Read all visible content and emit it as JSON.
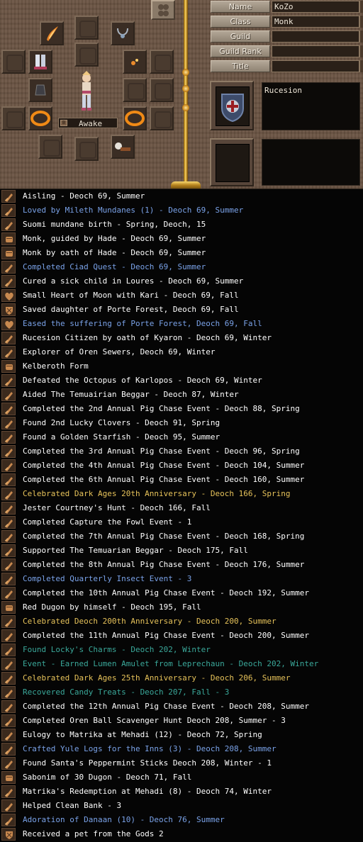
{
  "profile": {
    "status_label": "Awake",
    "status_hotkey": "B",
    "name_label": "Name",
    "name_value": "KoZo",
    "class_label": "Class",
    "class_value": "Monk",
    "guild_label": "Guild",
    "guild_value": "",
    "guild_rank_label": "Guild Rank",
    "guild_rank_value": "",
    "title_label": "Title",
    "title_value": "",
    "nation_value": "Rucesion"
  },
  "equipment_slots": [
    "helmet-ghost",
    "shield-ghost",
    "weapon",
    "earring-ghost",
    "necklace",
    "armor-ghost",
    "ring-left-ghost",
    "boots",
    "ring-right-ghost",
    "greaves-ghost",
    "gauntlet-left",
    "gauntlet-right",
    "belt-ghost",
    "accessory-ghost",
    "overcoat",
    "accessory2-ghost",
    "skull-item"
  ],
  "colors": {
    "white": "#ffffff",
    "blue": "#7aa2e8",
    "gold": "#e6c25a",
    "teal": "#3aa89a",
    "panel_brown": "#6a5443",
    "pole_gold": "#d9a52a"
  },
  "legend": [
    {
      "icon": "sword",
      "color": "white",
      "text": "Aisling - Deoch 69, Summer"
    },
    {
      "icon": "sword",
      "color": "blue",
      "text": "Loved by Mileth Mundanes (1) - Deoch 69, Summer"
    },
    {
      "icon": "sword",
      "color": "white",
      "text": "Suomi mundane birth - Spring, Deoch, 15"
    },
    {
      "icon": "fist",
      "color": "white",
      "text": "Monk, guided by Hade - Deoch 69, Summer"
    },
    {
      "icon": "fist",
      "color": "white",
      "text": "Monk by oath of Hade - Deoch 69, Summer"
    },
    {
      "icon": "sword",
      "color": "blue",
      "text": "Completed Ciad Quest - Deoch 69, Summer"
    },
    {
      "icon": "sword",
      "color": "white",
      "text": "Cured a sick child in Loures - Deoch 69, Summer"
    },
    {
      "icon": "heart",
      "color": "white",
      "text": "Small Heart of Moon with Kari - Deoch 69, Fall"
    },
    {
      "icon": "shield",
      "color": "white",
      "text": "Saved daughter of Porte Forest, Deoch 69, Fall"
    },
    {
      "icon": "heart",
      "color": "blue",
      "text": "Eased the suffering of Porte Forest, Deoch 69, Fall"
    },
    {
      "icon": "sword",
      "color": "white",
      "text": "Rucesion Citizen by oath of Kyaron - Deoch 69, Winter"
    },
    {
      "icon": "sword",
      "color": "white",
      "text": "Explorer of Oren Sewers, Deoch 69, Winter"
    },
    {
      "icon": "fist",
      "color": "white",
      "text": "Kelberoth Form"
    },
    {
      "icon": "sword",
      "color": "white",
      "text": "Defeated the Octopus of Karlopos - Deoch 69, Winter"
    },
    {
      "icon": "sword",
      "color": "white",
      "text": "Aided The Temuairian Beggar - Deoch 87, Winter"
    },
    {
      "icon": "sword",
      "color": "white",
      "text": "Completed the 2nd Annual Pig Chase Event - Deoch 88, Spring"
    },
    {
      "icon": "sword",
      "color": "white",
      "text": "Found 2nd Lucky Clovers - Deoch 91, Spring"
    },
    {
      "icon": "sword",
      "color": "white",
      "text": "Found a Golden Starfish - Deoch 95, Summer"
    },
    {
      "icon": "sword",
      "color": "white",
      "text": "Completed the 3rd Annual Pig Chase Event - Deoch 96, Spring"
    },
    {
      "icon": "sword",
      "color": "white",
      "text": "Completed the 4th Annual Pig Chase Event - Deoch 104, Summer"
    },
    {
      "icon": "sword",
      "color": "white",
      "text": "Completed the 6th Annual Pig Chase Event - Deoch 160, Summer"
    },
    {
      "icon": "sword",
      "color": "gold",
      "text": "Celebrated Dark Ages 20th Anniversary - Deoch 166, Spring"
    },
    {
      "icon": "sword",
      "color": "white",
      "text": "Jester Courtney's Hunt - Deoch 166, Fall"
    },
    {
      "icon": "sword",
      "color": "white",
      "text": "Completed Capture the Fowl Event - 1"
    },
    {
      "icon": "sword",
      "color": "white",
      "text": "Completed the 7th Annual Pig Chase Event - Deoch 168, Spring"
    },
    {
      "icon": "sword",
      "color": "white",
      "text": "Supported The Temuarian Beggar - Deoch 175, Fall"
    },
    {
      "icon": "sword",
      "color": "white",
      "text": "Completed the 8th Annual Pig Chase Event - Deoch 176, Summer"
    },
    {
      "icon": "sword",
      "color": "blue",
      "text": "Completed Quarterly Insect Event - 3"
    },
    {
      "icon": "sword",
      "color": "white",
      "text": "Completed the 10th Annual Pig Chase Event - Deoch 192, Summer"
    },
    {
      "icon": "fist",
      "color": "white",
      "text": "Red Dugon by himself - Deoch 195, Fall"
    },
    {
      "icon": "sword",
      "color": "gold",
      "text": "Celebrated Deoch 200th Anniversary - Deoch 200, Summer"
    },
    {
      "icon": "sword",
      "color": "white",
      "text": "Completed the 11th Annual Pig Chase Event - Deoch 200, Summer"
    },
    {
      "icon": "sword",
      "color": "teal",
      "text": "Found Locky's Charms - Deoch 202, Winter"
    },
    {
      "icon": "sword",
      "color": "teal",
      "text": "Event - Earned Lumen Amulet from Leprechaun - Deoch 202, Winter"
    },
    {
      "icon": "sword",
      "color": "gold",
      "text": "Celebrated Dark Ages 25th Anniversary - Deoch 206, Summer"
    },
    {
      "icon": "sword",
      "color": "teal",
      "text": "Recovered Candy Treats - Deoch 207, Fall - 3"
    },
    {
      "icon": "sword",
      "color": "white",
      "text": "Completed the 12th Annual Pig Chase Event - Deoch 208, Summer"
    },
    {
      "icon": "sword",
      "color": "white",
      "text": "Completed Oren Ball Scavenger Hunt Deoch 208, Summer - 3"
    },
    {
      "icon": "sword",
      "color": "white",
      "text": "Eulogy to Matrika at Mehadi (12) - Deoch 72, Spring"
    },
    {
      "icon": "sword",
      "color": "blue",
      "text": "Crafted Yule Logs for the Inns (3) - Deoch 208, Summer"
    },
    {
      "icon": "sword",
      "color": "white",
      "text": "Found Santa's Peppermint Sticks  Deoch 208, Winter - 1"
    },
    {
      "icon": "fist",
      "color": "white",
      "text": "Sabonim of 30 Dugon - Deoch 71, Fall"
    },
    {
      "icon": "sword",
      "color": "white",
      "text": "Matrika's Redemption at Mehadi (8) - Deoch 74, Winter"
    },
    {
      "icon": "sword",
      "color": "white",
      "text": "Helped Clean Bank - 3"
    },
    {
      "icon": "sword",
      "color": "blue",
      "text": "Adoration of Danaan (10) - Deoch 76, Summer"
    },
    {
      "icon": "shield",
      "color": "white",
      "text": "Received a pet from the Gods 2"
    }
  ]
}
